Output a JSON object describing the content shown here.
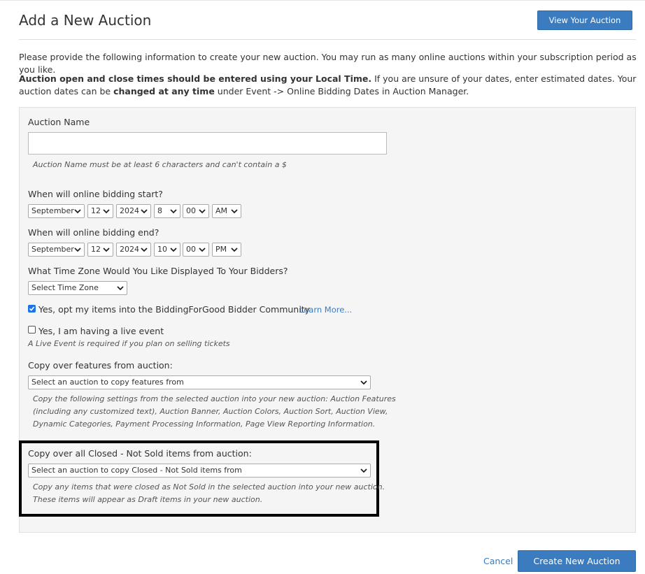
{
  "header": {
    "title": "Add a New Auction",
    "view_button": "View Your Auction"
  },
  "intro": {
    "text": "Please provide the following information to create your new auction. You may run as many online auctions within your subscription period as you like.",
    "note_bold1": "Auction open and close times should be entered using your Local Time.",
    "note_text1": " If you are unsure of your dates, enter estimated dates. Your auction dates can be ",
    "note_bold2": "changed at any time",
    "note_text2": " under Event -> Online Bidding Dates in Auction Manager."
  },
  "form": {
    "auction_name": {
      "label": "Auction Name",
      "value": "",
      "help": "Auction Name must be at least 6 characters and can't contain a $"
    },
    "start": {
      "label": "When will online bidding start?",
      "month": "September",
      "day": "12",
      "year": "2024",
      "hour": "8",
      "minute": "00",
      "ampm": "AM"
    },
    "end": {
      "label": "When will online bidding end?",
      "month": "September",
      "day": "12",
      "year": "2024",
      "hour": "10",
      "minute": "00",
      "ampm": "PM"
    },
    "timezone": {
      "label": "What Time Zone Would You Like Displayed To Your Bidders?",
      "selected": "Select Time Zone"
    },
    "community": {
      "checked": true,
      "label": "Yes, opt my items into the BiddingForGood Bidder Community",
      "link": "Learn More..."
    },
    "live_event": {
      "checked": false,
      "label": "Yes, I am having a live event",
      "help": "A Live Event is required if you plan on selling tickets"
    },
    "copy_features": {
      "label": "Copy over features from auction:",
      "selected": "Select an auction to copy features from",
      "help_line1": "Copy the following settings from the selected auction into your new auction: Auction Features",
      "help_line2": "(including any customized text), Auction Banner, Auction Colors, Auction Sort, Auction View,",
      "help_line3": "Dynamic Categories, Payment Processing Information, Page View Reporting Information."
    },
    "copy_items": {
      "label": "Copy over all Closed - Not Sold items from auction:",
      "selected": "Select an auction to copy Closed - Not Sold items from",
      "help_line1": "Copy any items that were closed as Not Sold in the selected auction into your new auction.",
      "help_line2": "These items will appear as Draft items in your new auction."
    }
  },
  "footer": {
    "cancel": "Cancel",
    "create": "Create New Auction"
  },
  "colors": {
    "accent": "#3a7cbf",
    "highlight_border": "#000000",
    "panel_bg": "#f5f5f5"
  }
}
